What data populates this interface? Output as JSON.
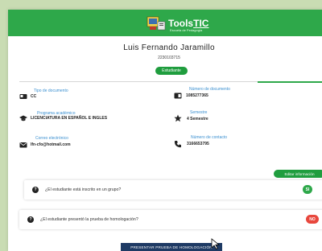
{
  "header": {
    "logo_name": "Tools",
    "logo_suffix": "TIC",
    "logo_subtitle": "Escuela de Pedagogía"
  },
  "student": {
    "name": "Luis Fernando Jaramillo",
    "code": "2230103715",
    "role_badge": "Estudiante"
  },
  "fields": {
    "doc_type": {
      "label": "Tipo de documento",
      "value": "CC",
      "icon": "id-card-icon"
    },
    "doc_number": {
      "label": "Número de documento",
      "value": "1085277365",
      "icon": "id-badge-icon"
    },
    "program": {
      "label": "Programa académico",
      "value": "LICENCIATURA EN ESPAÑOL E INGLES",
      "icon": "graduation-cap-icon"
    },
    "semester": {
      "label": "Semestre",
      "value": "4 Semestre",
      "icon": "star-icon"
    },
    "email": {
      "label": "Correo electrónico",
      "value": "lfn-cfo@hotmail.com",
      "icon": "envelope-icon"
    },
    "phone": {
      "label": "Número de contacto",
      "value": "3166653795",
      "icon": "phone-icon"
    }
  },
  "actions": {
    "edit_label": "Editar información",
    "submit_label": "PRESENTAR PRUEBA DE HOMOLOGACIÓN"
  },
  "questions": [
    {
      "text": "¿El estudiante está inscrito en un grupo?",
      "badge": "SI",
      "badge_color": "#2ea84a"
    },
    {
      "text": "¿El estudiante presentó la prueba de homologación?",
      "badge": "NO",
      "badge_color": "#e8473d"
    }
  ],
  "colors": {
    "header_green": "#2ea84a",
    "badge_green": "#1f9d3e",
    "label_blue": "#3a8fd0",
    "submit_navy": "#1e3a64",
    "page_bg": "#c9dcb3"
  }
}
